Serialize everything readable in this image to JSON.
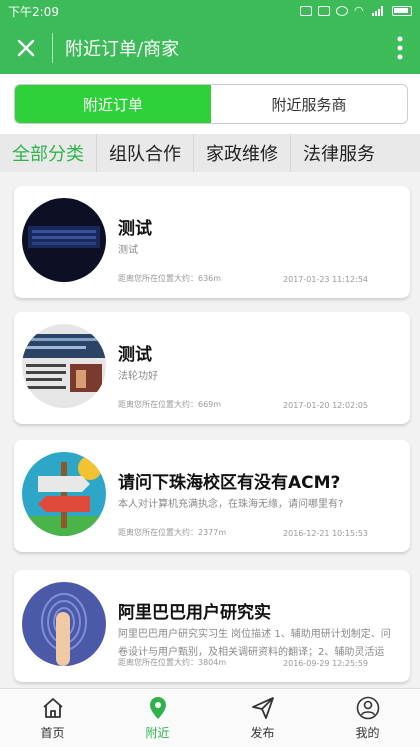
{
  "status": {
    "time": "下午2:09"
  },
  "app_bar": {
    "title": "附近订单/商家"
  },
  "segmented": [
    {
      "label": "附近订单",
      "active": true
    },
    {
      "label": "附近服务商",
      "active": false
    }
  ],
  "categories": [
    {
      "label": "全部分类",
      "active": true
    },
    {
      "label": "组队合作",
      "active": false
    },
    {
      "label": "家政维修",
      "active": false
    },
    {
      "label": "法律服务",
      "active": false
    }
  ],
  "items": [
    {
      "title": "测试",
      "desc": "测试",
      "distance": "距离您所在位置大约：636m",
      "date": "2017-01-23 11:12:54",
      "thumb": "dark-pattern"
    },
    {
      "title": "测试",
      "desc": "法轮功好",
      "distance": "距离您所在位置大约：669m",
      "date": "2017-01-20 12:02:05",
      "thumb": "newspaper"
    },
    {
      "title": "请问下珠海校区有没有ACM?",
      "desc": "本人对计算机充满执念，在珠海无缘，请问哪里有?",
      "distance": "距离您所在位置大约：2377m",
      "date": "2016-12-21 10:15:53",
      "thumb": "signpost"
    },
    {
      "title": "阿里巴巴用户研究实",
      "desc": "阿里巴巴用户研究实习生 岗位描述 1、辅助用研计划制定、问卷设计与用户甄别，及相关调研资料的翻译；2、辅助灵活运",
      "distance": "距离您所在位置大约：3804m",
      "date": "2016-09-29 12:25:59",
      "thumb": "fingerprint"
    }
  ],
  "bottom_nav": [
    {
      "label": "首页",
      "icon": "home-icon",
      "active": false
    },
    {
      "label": "附近",
      "icon": "location-pin-icon",
      "active": true
    },
    {
      "label": "发布",
      "icon": "send-icon",
      "active": false
    },
    {
      "label": "我的",
      "icon": "user-icon",
      "active": false
    }
  ],
  "colors": {
    "primary": "#3dbb58",
    "active_segment": "#2fd13a",
    "active_text": "#2fb24b"
  }
}
